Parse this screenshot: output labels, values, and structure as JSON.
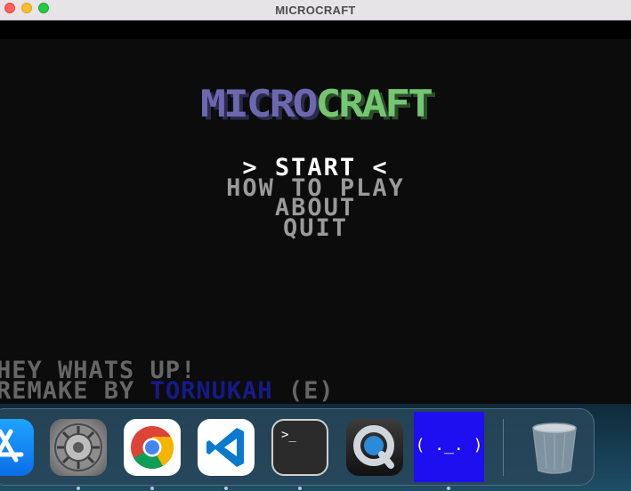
{
  "window": {
    "title": "MICROCRAFT"
  },
  "game": {
    "logo_part1": "MICRO",
    "logo_part2": "CRAFT",
    "menu": {
      "selected": "> START <",
      "items": [
        "HOW TO PLAY",
        "ABOUT",
        "QUIT"
      ]
    },
    "footer": {
      "line1": "HEY WHATS UP!",
      "line2_prefix": "REMAKE BY ",
      "author": "TORNUKAH",
      "line2_suffix": " (E)"
    },
    "colors": {
      "logo_micro": "#6c68b0",
      "logo_craft": "#74c670",
      "author": "#161a88"
    }
  },
  "dock": {
    "apps": [
      {
        "name": "App Store",
        "icon": "app-store-icon"
      },
      {
        "name": "System Settings",
        "icon": "gear-icon"
      },
      {
        "name": "Google Chrome",
        "icon": "chrome-icon"
      },
      {
        "name": "Visual Studio Code",
        "icon": "vscode-icon"
      },
      {
        "name": "Terminal",
        "icon": "terminal-icon",
        "glyph": ">_"
      },
      {
        "name": "QuickTime Player",
        "icon": "quicktime-icon"
      },
      {
        "name": "Microcraft",
        "icon": "microcraft-face-icon",
        "glyph": "( ._. )"
      },
      {
        "name": "Trash",
        "icon": "trash-icon"
      }
    ]
  }
}
